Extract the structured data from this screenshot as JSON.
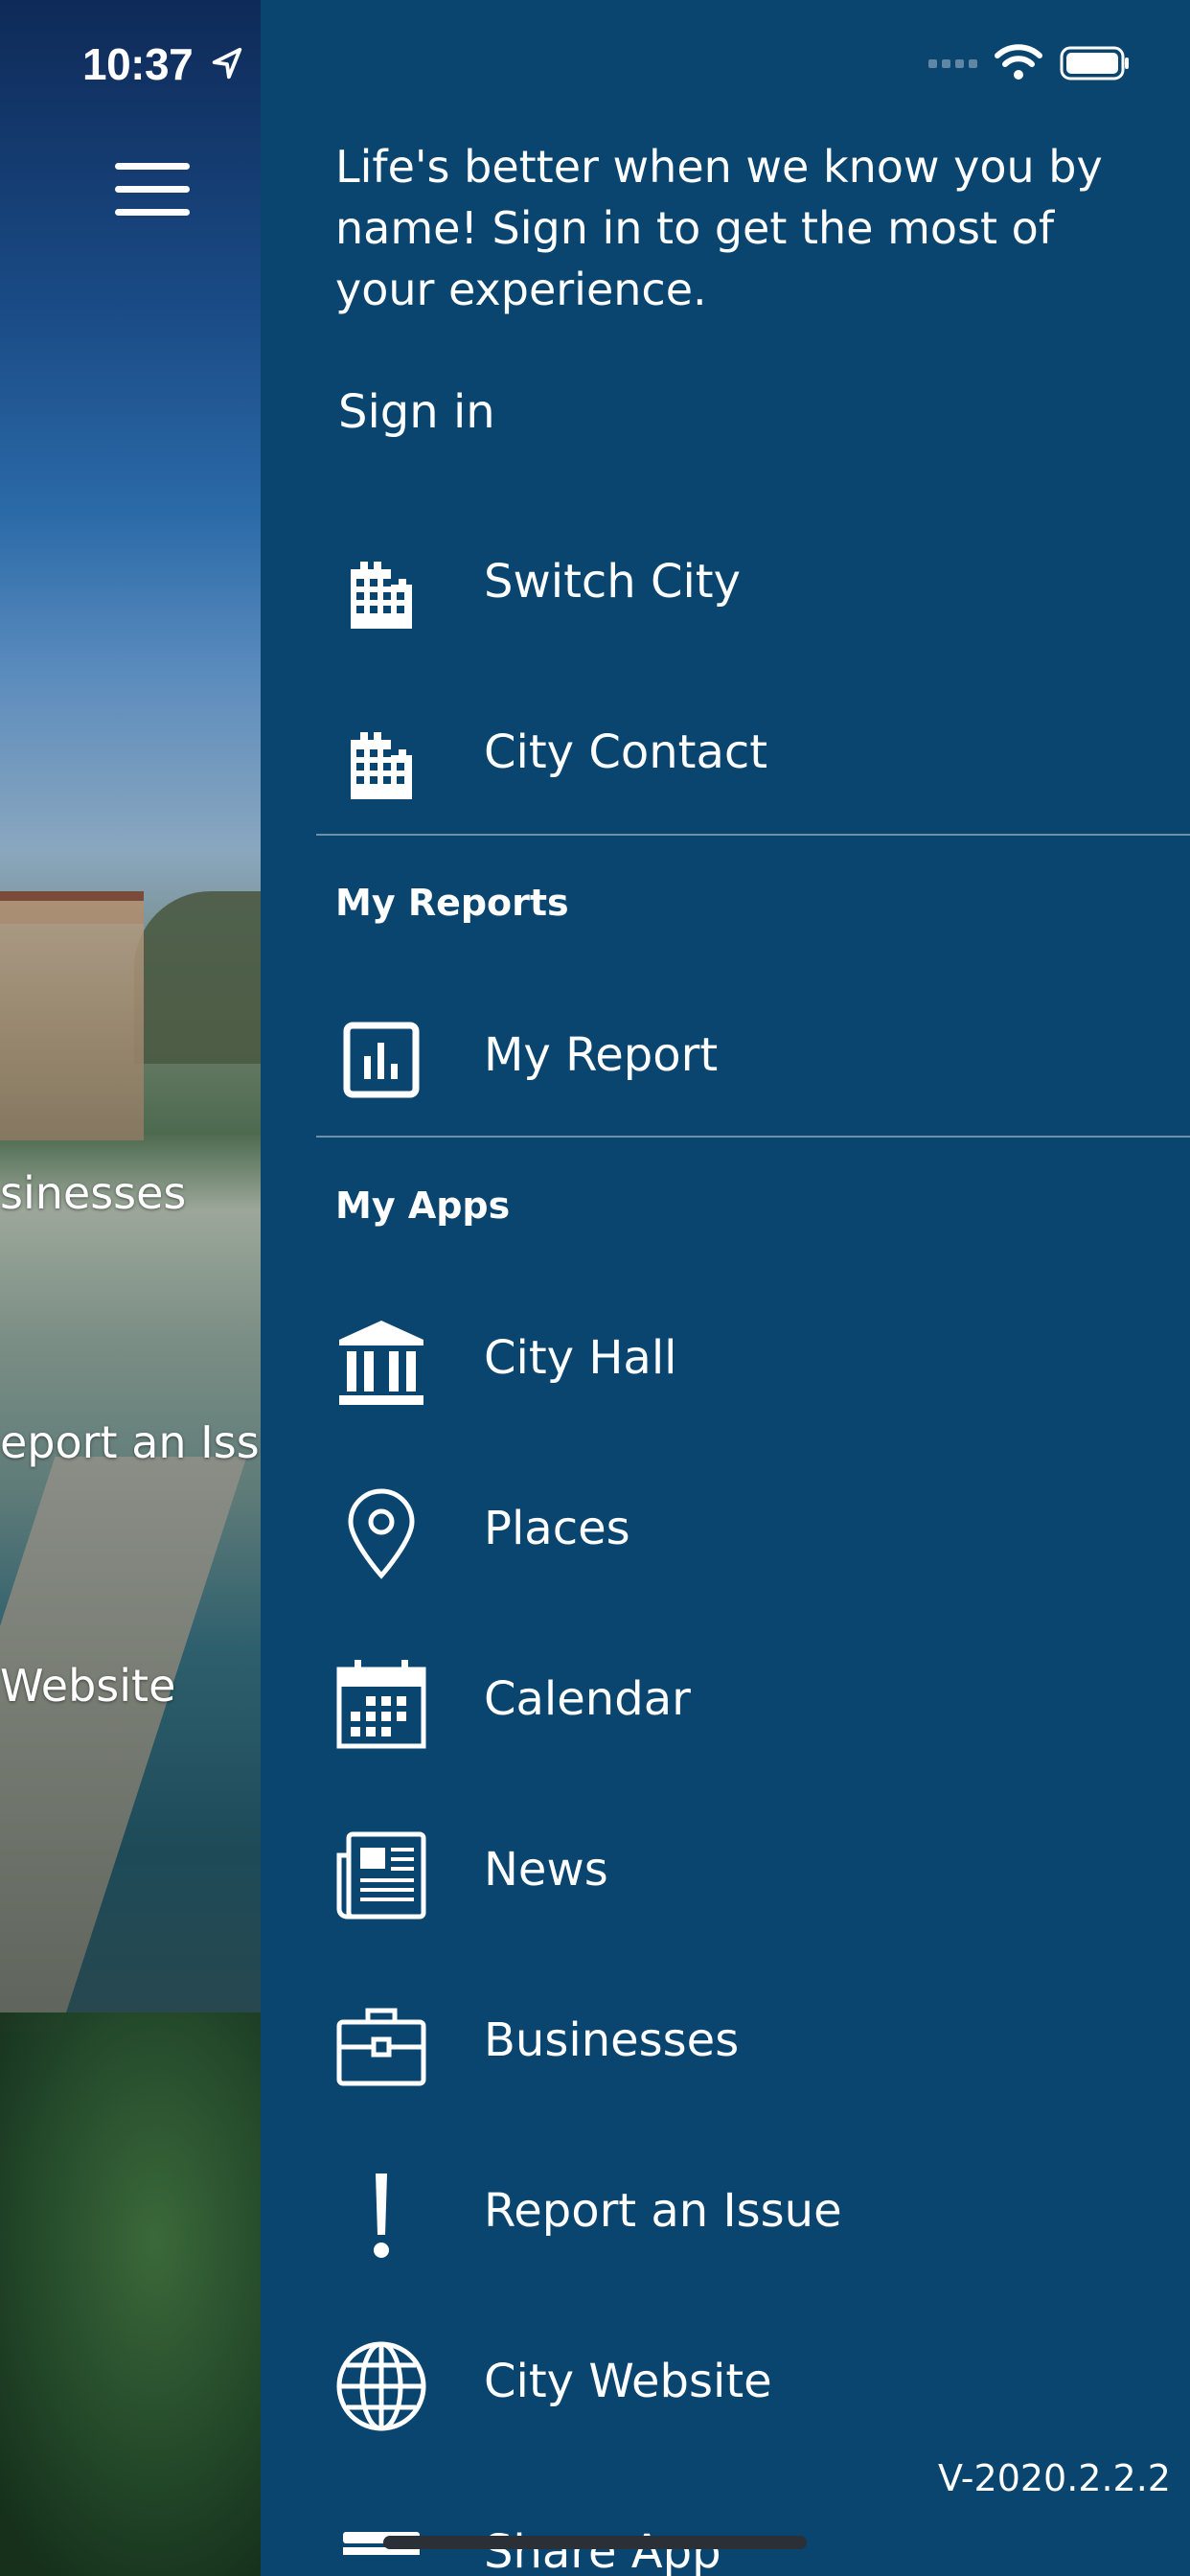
{
  "status_bar": {
    "time": "10:37",
    "location_icon": "location-arrow-icon",
    "wifi_icon": "wifi-icon",
    "battery_icon": "battery-icon"
  },
  "background_app": {
    "menu_icon": "hamburger-menu-icon",
    "visible_labels": [
      "sinesses",
      "eport an Issu",
      "Website"
    ]
  },
  "drawer": {
    "intro": "Life's better when we know you by name! Sign in to get the most of your experience.",
    "sign_in_label": "Sign in",
    "top_items": [
      {
        "label": "Switch City",
        "icon": "building-icon"
      },
      {
        "label": "City Contact",
        "icon": "building-icon"
      }
    ],
    "my_reports": {
      "title": "My Reports",
      "items": [
        {
          "label": "My Report",
          "icon": "bar-chart-icon"
        }
      ]
    },
    "my_apps": {
      "title": "My Apps",
      "items": [
        {
          "label": "City Hall",
          "icon": "city-hall-icon"
        },
        {
          "label": "Places",
          "icon": "map-pin-icon"
        },
        {
          "label": "Calendar",
          "icon": "calendar-icon"
        },
        {
          "label": "News",
          "icon": "newspaper-icon"
        },
        {
          "label": "Businesses",
          "icon": "briefcase-icon"
        },
        {
          "label": "Report an Issue",
          "icon": "exclamation-icon"
        },
        {
          "label": "City Website",
          "icon": "globe-icon"
        },
        {
          "label": "Share App",
          "icon": "share-icon"
        }
      ]
    },
    "version": "V-2020.2.2.2"
  },
  "colors": {
    "drawer_bg": "#0a4570",
    "divider": "#6f90ad",
    "text": "#ffffff"
  }
}
